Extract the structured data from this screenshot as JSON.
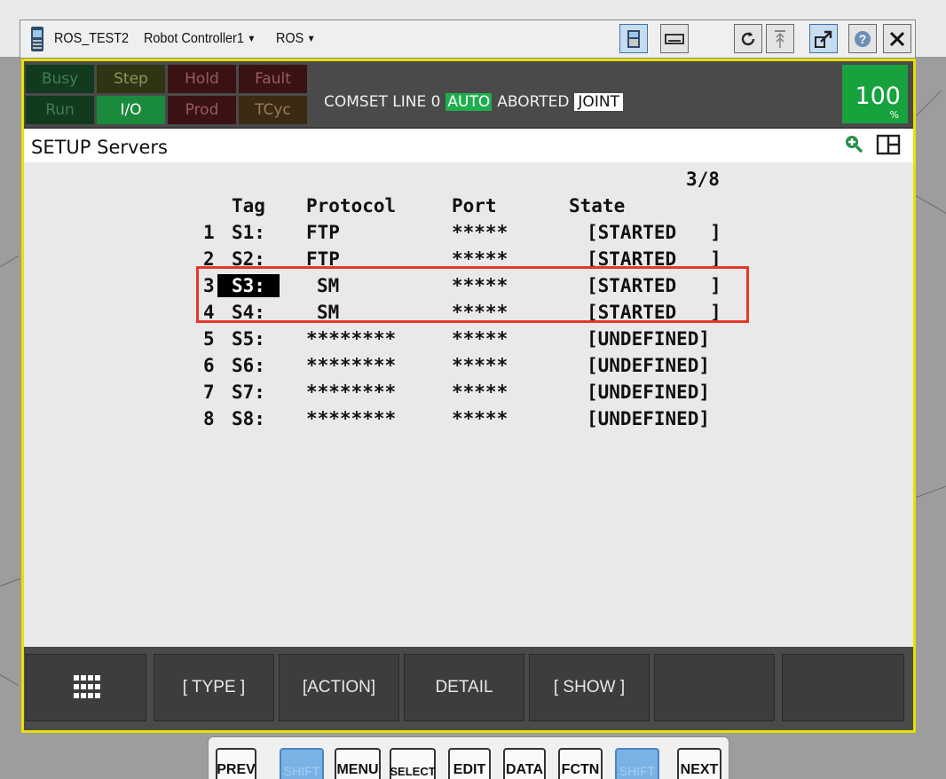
{
  "window": {
    "titles": [
      {
        "label": "ROS_TEST2",
        "caret": ""
      },
      {
        "label": "Robot Controller1",
        "caret": "▼"
      },
      {
        "label": "ROS",
        "caret": "▼"
      }
    ],
    "toolbar_icons": [
      "teach-pendant-icon",
      "keyboard-icon",
      "refresh-icon",
      "jog-icon",
      "external-window-icon",
      "help-icon",
      "close-icon"
    ]
  },
  "status": {
    "leds": [
      {
        "label": "Busy",
        "state": "off",
        "color": "green"
      },
      {
        "label": "Step",
        "state": "off",
        "color": "yellow"
      },
      {
        "label": "Hold",
        "state": "off",
        "color": "red"
      },
      {
        "label": "Fault",
        "state": "off",
        "color": "red"
      },
      {
        "label": "Run",
        "state": "off",
        "color": "green"
      },
      {
        "label": "I/O",
        "state": "on",
        "color": "green"
      },
      {
        "label": "Prod",
        "state": "off",
        "color": "red"
      },
      {
        "label": "TCyc",
        "state": "off",
        "color": "orange"
      }
    ],
    "line_text": "COMSET LINE 0",
    "auto": "AUTO",
    "aborted": "ABORTED",
    "joint": "JOINT",
    "override_value": "100",
    "override_unit": "%"
  },
  "screen": {
    "title": "SETUP Servers",
    "page_indicator": "3/8",
    "columns": {
      "tag": "Tag",
      "protocol": "Protocol",
      "port": "Port",
      "state": "State"
    },
    "rows": [
      {
        "num": "1",
        "tag": "S1:",
        "protocol": "FTP",
        "port": "*****",
        "state": "[STARTED   ]"
      },
      {
        "num": "2",
        "tag": "S2:",
        "protocol": "FTP",
        "port": "*****",
        "state": "[STARTED   ]"
      },
      {
        "num": "3",
        "tag": "S3:",
        "protocol": "SM",
        "port": "*****",
        "state": "[STARTED   ]"
      },
      {
        "num": "4",
        "tag": "S4:",
        "protocol": "SM",
        "port": "*****",
        "state": "[STARTED   ]"
      },
      {
        "num": "5",
        "tag": "S5:",
        "protocol": "********",
        "port": "*****",
        "state": "[UNDEFINED]"
      },
      {
        "num": "6",
        "tag": "S6:",
        "protocol": "********",
        "port": "*****",
        "state": "[UNDEFINED]"
      },
      {
        "num": "7",
        "tag": "S7:",
        "protocol": "********",
        "port": "*****",
        "state": "[UNDEFINED]"
      },
      {
        "num": "8",
        "tag": "S8:",
        "protocol": "********",
        "port": "*****",
        "state": "[UNDEFINED]"
      }
    ],
    "selected_row": 3,
    "highlight_color": "#e8362c"
  },
  "function_keys": [
    "",
    "[ TYPE ]",
    "[ACTION]",
    "DETAIL",
    "[ SHOW ]",
    "",
    ""
  ],
  "hard_keys": [
    "PREV",
    "SHIFT",
    "MENU",
    "SELECT",
    "EDIT",
    "DATA",
    "FCTN",
    "SHIFT",
    "NEXT"
  ]
}
